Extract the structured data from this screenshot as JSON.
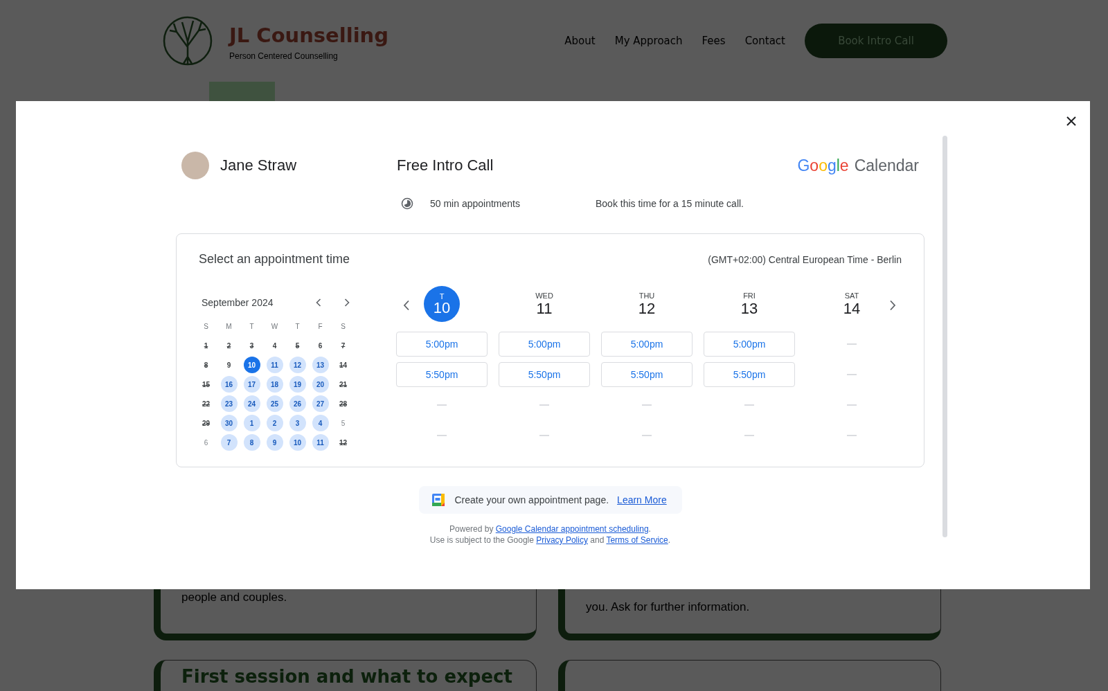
{
  "site": {
    "title": "JL Counselling",
    "tagline": "Person Centered Counselling",
    "nav": [
      "About",
      "My Approach",
      "Fees",
      "Contact"
    ],
    "cta": "Book Intro Call",
    "cards": [
      {
        "text": "people and couples."
      },
      {
        "text": "you. Ask for further information."
      }
    ],
    "cards_row2": [
      {
        "heading": "First session and what to expect"
      }
    ]
  },
  "booking": {
    "host": "Jane Straw",
    "title": "Free Intro Call",
    "brand": {
      "google": "Google",
      "product": "Calendar"
    },
    "duration": "50 min appointments",
    "description": "Book this time for a 15 minute call.",
    "panel_title": "Select an appointment time",
    "timezone": "(GMT+02:00) Central European Time - Berlin",
    "month": "September 2024",
    "weekdays": [
      "S",
      "M",
      "T",
      "W",
      "T",
      "F",
      "S"
    ],
    "weeks": [
      [
        {
          "day": "1",
          "kind": "struck",
          "selected": false
        },
        {
          "day": "2",
          "kind": "struck",
          "selected": false
        },
        {
          "day": "3",
          "kind": "struck",
          "selected": false
        },
        {
          "day": "4",
          "kind": "plain",
          "selected": false
        },
        {
          "day": "5",
          "kind": "struck",
          "selected": false
        },
        {
          "day": "6",
          "kind": "plain",
          "selected": false
        },
        {
          "day": "7",
          "kind": "struck",
          "selected": false
        }
      ],
      [
        {
          "day": "8",
          "kind": "struck",
          "selected": false
        },
        {
          "day": "9",
          "kind": "plain",
          "selected": false
        },
        {
          "day": "10",
          "kind": "available",
          "selected": true
        },
        {
          "day": "11",
          "kind": "available",
          "selected": false
        },
        {
          "day": "12",
          "kind": "available",
          "selected": false
        },
        {
          "day": "13",
          "kind": "available",
          "selected": false
        },
        {
          "day": "14",
          "kind": "struck",
          "selected": false
        }
      ],
      [
        {
          "day": "15",
          "kind": "struck",
          "selected": false
        },
        {
          "day": "16",
          "kind": "available",
          "selected": false
        },
        {
          "day": "17",
          "kind": "available",
          "selected": false
        },
        {
          "day": "18",
          "kind": "available",
          "selected": false
        },
        {
          "day": "19",
          "kind": "available",
          "selected": false
        },
        {
          "day": "20",
          "kind": "available",
          "selected": false
        },
        {
          "day": "21",
          "kind": "struck",
          "selected": false
        }
      ],
      [
        {
          "day": "22",
          "kind": "struck",
          "selected": false
        },
        {
          "day": "23",
          "kind": "available",
          "selected": false
        },
        {
          "day": "24",
          "kind": "available",
          "selected": false
        },
        {
          "day": "25",
          "kind": "available",
          "selected": false
        },
        {
          "day": "26",
          "kind": "available",
          "selected": false
        },
        {
          "day": "27",
          "kind": "available",
          "selected": false
        },
        {
          "day": "28",
          "kind": "struck",
          "selected": false
        }
      ],
      [
        {
          "day": "29",
          "kind": "struck",
          "selected": false
        },
        {
          "day": "30",
          "kind": "available",
          "selected": false
        },
        {
          "day": "1",
          "kind": "available",
          "selected": false
        },
        {
          "day": "2",
          "kind": "available",
          "selected": false
        },
        {
          "day": "3",
          "kind": "available",
          "selected": false
        },
        {
          "day": "4",
          "kind": "available",
          "selected": false
        },
        {
          "day": "5",
          "kind": "muted",
          "selected": false
        }
      ],
      [
        {
          "day": "6",
          "kind": "muted",
          "selected": false
        },
        {
          "day": "7",
          "kind": "available",
          "selected": false
        },
        {
          "day": "8",
          "kind": "available",
          "selected": false
        },
        {
          "day": "9",
          "kind": "available",
          "selected": false
        },
        {
          "day": "10",
          "kind": "available",
          "selected": false
        },
        {
          "day": "11",
          "kind": "available",
          "selected": false
        },
        {
          "day": "12",
          "kind": "struck",
          "selected": false
        }
      ]
    ],
    "days": [
      {
        "label": "T",
        "date": "10",
        "selected": true,
        "slots": [
          {
            "kind": "time",
            "time": "5:00pm"
          },
          {
            "kind": "time",
            "time": "5:50pm"
          },
          {
            "kind": "empty"
          },
          {
            "kind": "empty"
          }
        ]
      },
      {
        "label": "WED",
        "date": "11",
        "selected": false,
        "slots": [
          {
            "kind": "time",
            "time": "5:00pm"
          },
          {
            "kind": "time",
            "time": "5:50pm"
          },
          {
            "kind": "empty"
          },
          {
            "kind": "empty"
          }
        ]
      },
      {
        "label": "THU",
        "date": "12",
        "selected": false,
        "slots": [
          {
            "kind": "time",
            "time": "5:00pm"
          },
          {
            "kind": "time",
            "time": "5:50pm"
          },
          {
            "kind": "empty"
          },
          {
            "kind": "empty"
          }
        ]
      },
      {
        "label": "FRI",
        "date": "13",
        "selected": false,
        "slots": [
          {
            "kind": "time",
            "time": "5:00pm"
          },
          {
            "kind": "time",
            "time": "5:50pm"
          },
          {
            "kind": "empty"
          },
          {
            "kind": "empty"
          }
        ]
      },
      {
        "label": "SAT",
        "date": "14",
        "selected": false,
        "slots": [
          {
            "kind": "empty"
          },
          {
            "kind": "empty"
          },
          {
            "kind": "empty"
          },
          {
            "kind": "empty"
          }
        ]
      }
    ],
    "promo": {
      "text": "Create your own appointment page.",
      "link": "Learn More"
    },
    "footer": [
      [
        {
          "kind": "text",
          "text": "Powered by "
        },
        {
          "kind": "link",
          "text": "Google Calendar appointment scheduling"
        },
        {
          "kind": "text",
          "text": "."
        }
      ],
      [
        {
          "kind": "text",
          "text": "Use is subject to the Google "
        },
        {
          "kind": "link",
          "text": "Privacy Policy"
        },
        {
          "kind": "text",
          "text": " and "
        },
        {
          "kind": "link",
          "text": "Terms of Service"
        },
        {
          "kind": "text",
          "text": "."
        }
      ]
    ]
  }
}
